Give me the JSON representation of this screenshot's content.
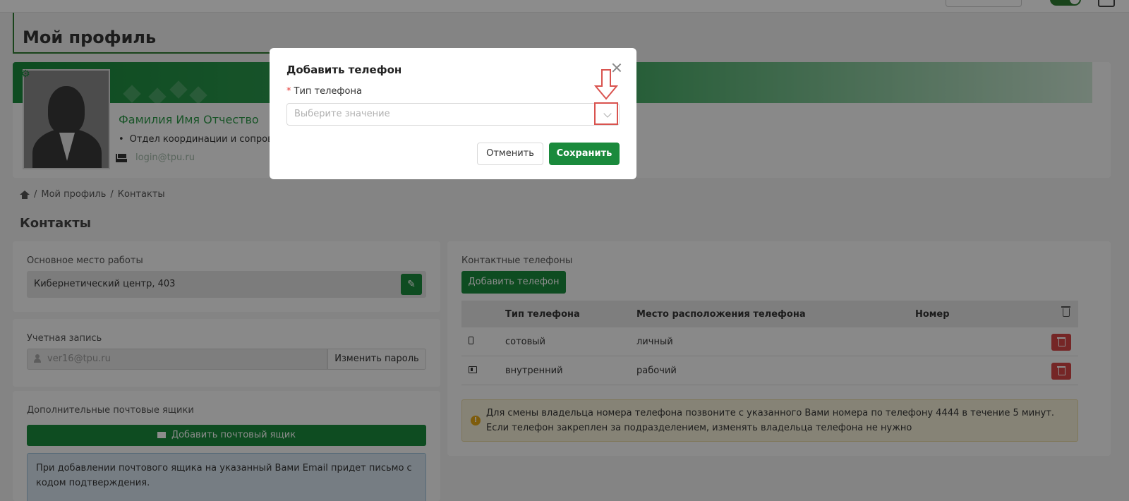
{
  "page": {
    "title": "Мой профиль"
  },
  "profile": {
    "full_name": "Фамилия Имя Отчество",
    "department": "Отдел координации и сопрово",
    "email": "login@tpu.ru"
  },
  "breadcrumb": {
    "items": [
      "Мой профиль",
      "Контакты"
    ],
    "separator": "/"
  },
  "section_title": "Контакты",
  "workplace": {
    "label": "Основное место работы",
    "value": "Кибернетический центр, 403"
  },
  "account": {
    "label": "Учетная запись",
    "value": "ver16@tpu.ru",
    "change_password": "Изменить пароль"
  },
  "mailboxes": {
    "label": "Дополнительные почтовые ящики",
    "add_button": "Добавить почтовый ящик",
    "info_text": "При добавлении почтового ящика на указанный Вами Email придет письмо с кодом подтверждения."
  },
  "phones": {
    "label": "Контактные телефоны",
    "add_button": "Добавить телефон",
    "columns": [
      "Тип телефона",
      "Место расположения телефона",
      "Номер"
    ],
    "rows": [
      {
        "icon": "mobile-phone-icon",
        "type": "сотовый",
        "location": "личный",
        "number": ""
      },
      {
        "icon": "desk-phone-icon",
        "type": "внутренний",
        "location": "рабочий",
        "number": ""
      }
    ],
    "warning": "Для смены владельца номера телефона позвоните с указанного Вами номера по телефону 4444 в течение 5 минут. Если телефон закреплен за подразделением, изменять владельца телефона не нужно"
  },
  "modal": {
    "title": "Добавить телефон",
    "field_label": "Тип телефона",
    "required_mark": "*",
    "select_placeholder": "Выберите значение",
    "cancel": "Отменить",
    "save": "Сохранить"
  },
  "colors": {
    "brand_green": "#1a8a3c",
    "danger_red": "#d64545",
    "highlight_red": "#d9534f"
  }
}
